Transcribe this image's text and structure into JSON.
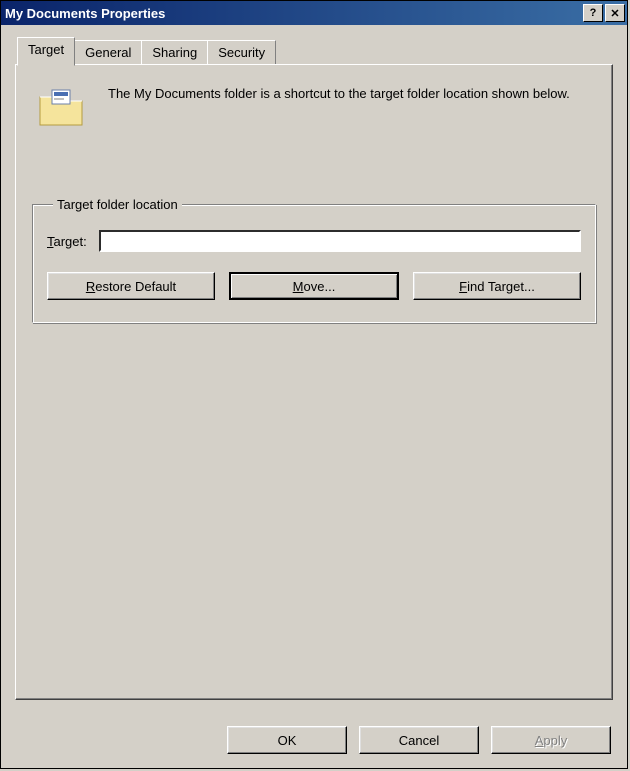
{
  "window": {
    "title": "My Documents Properties",
    "help": "?",
    "close": "✕"
  },
  "tabs": {
    "target": "Target",
    "general": "General",
    "sharing": "Sharing",
    "security": "Security"
  },
  "info": {
    "text": "The My Documents folder is a shortcut to the target folder location shown below."
  },
  "group": {
    "legend": "Target folder location",
    "target_label_pre": "T",
    "target_label_post": "arget:",
    "target_value": "",
    "restore_pre": "R",
    "restore_post": "estore Default",
    "move_pre": "M",
    "move_post": "ove...",
    "find_pre": "F",
    "find_post": "ind Target..."
  },
  "footer": {
    "ok": "OK",
    "cancel": "Cancel",
    "apply_pre": "A",
    "apply_post": "pply"
  }
}
